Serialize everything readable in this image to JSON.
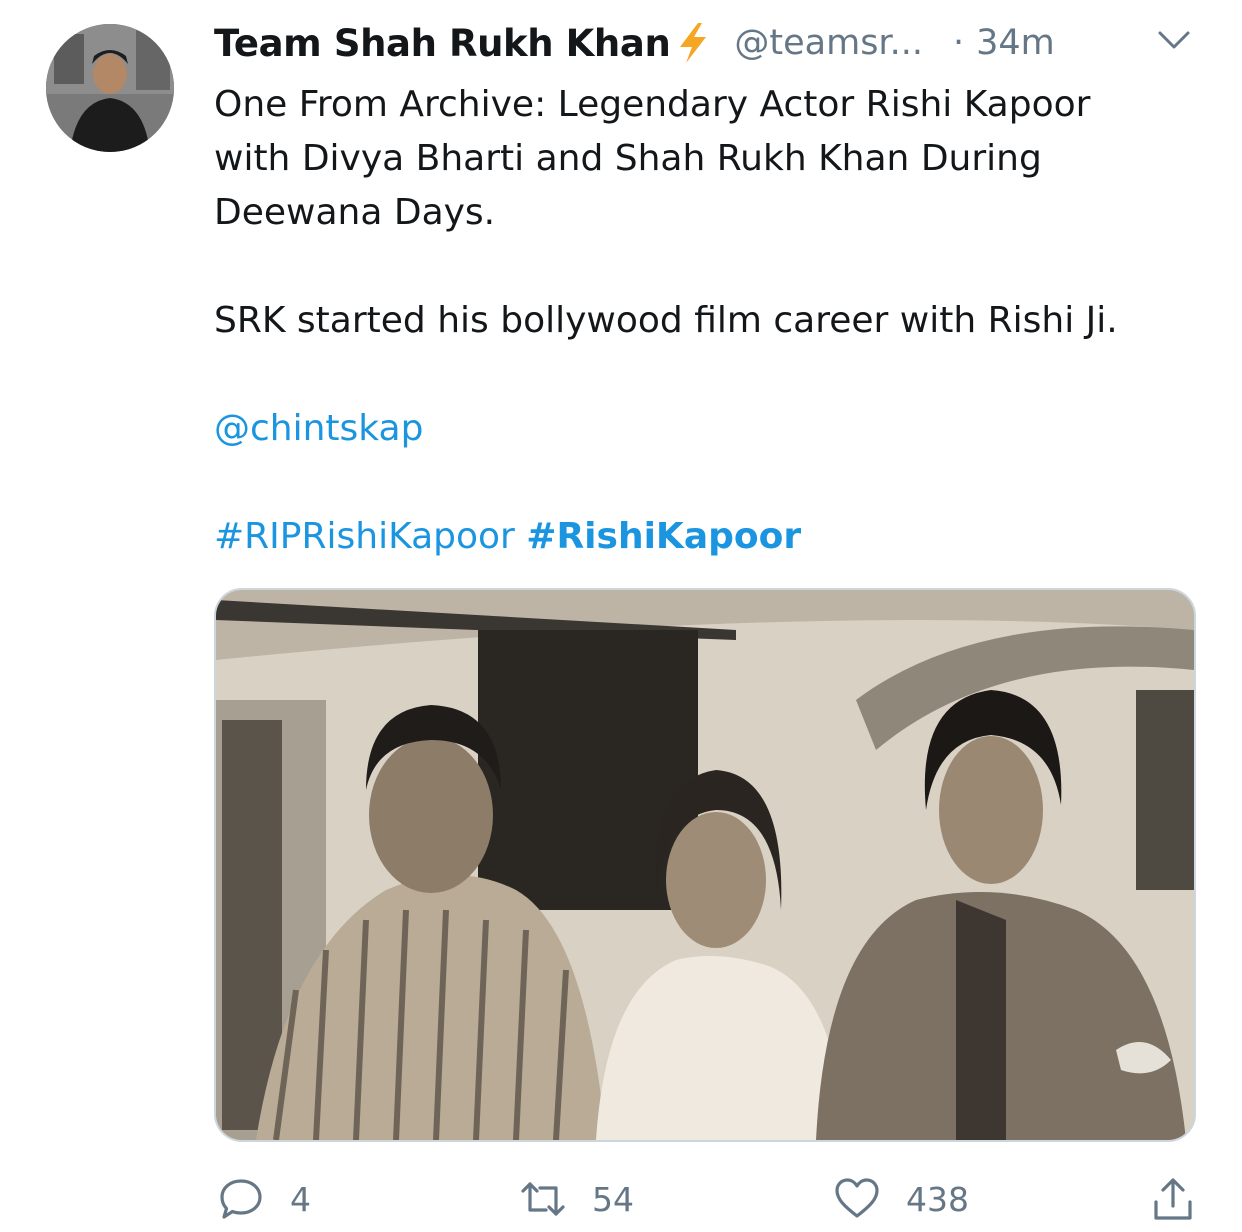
{
  "tweet": {
    "display_name": "Team Shah Rukh Khan",
    "handle": "@teamsr...",
    "separator": "·",
    "time": "34m",
    "verified_badge_icon": "lightning-bolt-icon",
    "menu_icon": "chevron-down-icon",
    "body": {
      "line1": "One From Archive: Legendary Actor Rishi Kapoor",
      "line2": "with Divya Bharti and Shah Rukh Khan During",
      "line3": "Deewana Days.",
      "line4": "SRK started his bollywood film career with Rishi Ji.",
      "mention": "@chintskap",
      "hashtag1": "#RIPRishiKapoor",
      "hashtag2": "#RishiKapoor"
    },
    "media_icon": "archive-photo-image",
    "actions": {
      "reply": {
        "icon": "reply-icon",
        "count": "4"
      },
      "retweet": {
        "icon": "retweet-icon",
        "count": "54"
      },
      "like": {
        "icon": "heart-icon",
        "count": "438"
      },
      "share": {
        "icon": "share-icon"
      }
    }
  },
  "colors": {
    "link": "#1b95e0",
    "text_primary": "#14171a",
    "text_secondary": "#657786",
    "bolt": "#f5a623",
    "border": "#ccd6dd"
  }
}
